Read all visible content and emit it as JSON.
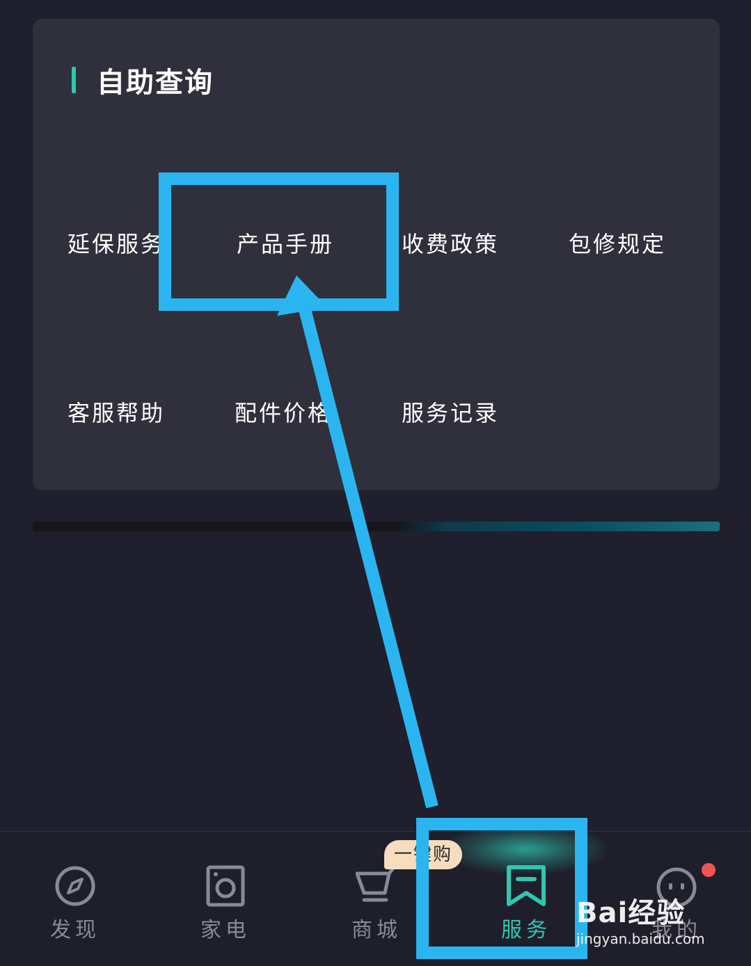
{
  "section": {
    "title": "自助查询",
    "accent_color": "#2ec7b0"
  },
  "grid_items": [
    {
      "label": "延保服务"
    },
    {
      "label": "产品手册"
    },
    {
      "label": "收费政策"
    },
    {
      "label": "包修规定"
    },
    {
      "label": "客服帮助"
    },
    {
      "label": "配件价格"
    },
    {
      "label": "服务记录"
    }
  ],
  "bottom_nav": {
    "items": [
      {
        "label": "发现",
        "icon": "compass-icon",
        "active": false
      },
      {
        "label": "家电",
        "icon": "washer-icon",
        "active": false
      },
      {
        "label": "商城",
        "icon": "cart-icon",
        "active": false
      },
      {
        "label": "服务",
        "icon": "service-bookmark-icon",
        "active": true
      },
      {
        "label": "我的",
        "icon": "robot-face-icon",
        "active": false
      }
    ],
    "promo_badge": "一键购",
    "active_color": "#2ec7b0",
    "inactive_color": "#8a8a96"
  },
  "annotation": {
    "color": "#2bb5f0"
  },
  "watermark": {
    "brand": "Bai经验",
    "site": "jingyan.baidu.com"
  }
}
